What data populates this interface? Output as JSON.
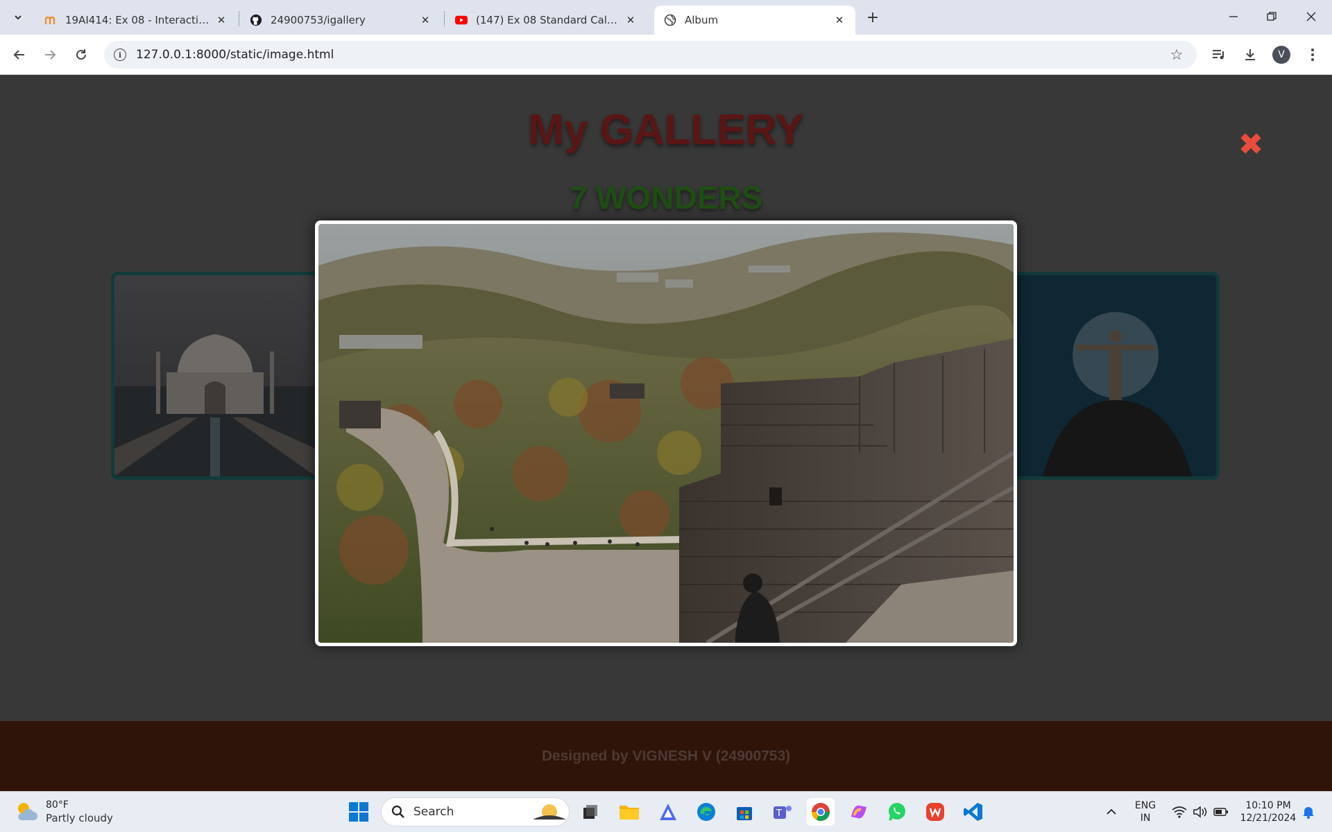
{
  "browser": {
    "tabs": [
      {
        "title": "19AI414: Ex 08 - Interactive Ima",
        "icon": "moodle-icon"
      },
      {
        "title": "24900753/igallery",
        "icon": "github-icon"
      },
      {
        "title": "(147) Ex 08 Standard Calculator",
        "icon": "youtube-icon"
      },
      {
        "title": "Album",
        "icon": "globe-icon",
        "active": true
      }
    ],
    "url": "127.0.0.1:8000/static/image.html",
    "profile_initial": "V"
  },
  "page": {
    "title": "My GALLERY",
    "subtitle": "7 WONDERS",
    "footer": "Designed by VIGNESH V (24900753)",
    "close_symbol": "✖"
  },
  "taskbar": {
    "weather_temp": "80°F",
    "weather_desc": "Partly cloudy",
    "search_label": "Search",
    "lang_top": "ENG",
    "lang_bottom": "IN",
    "time": "10:10 PM",
    "date": "12/21/2024"
  },
  "colors": {
    "title": "#5a1515",
    "subtitle": "#1f4d14",
    "close": "#e94c3d",
    "footer_bg": "#2f1409"
  }
}
